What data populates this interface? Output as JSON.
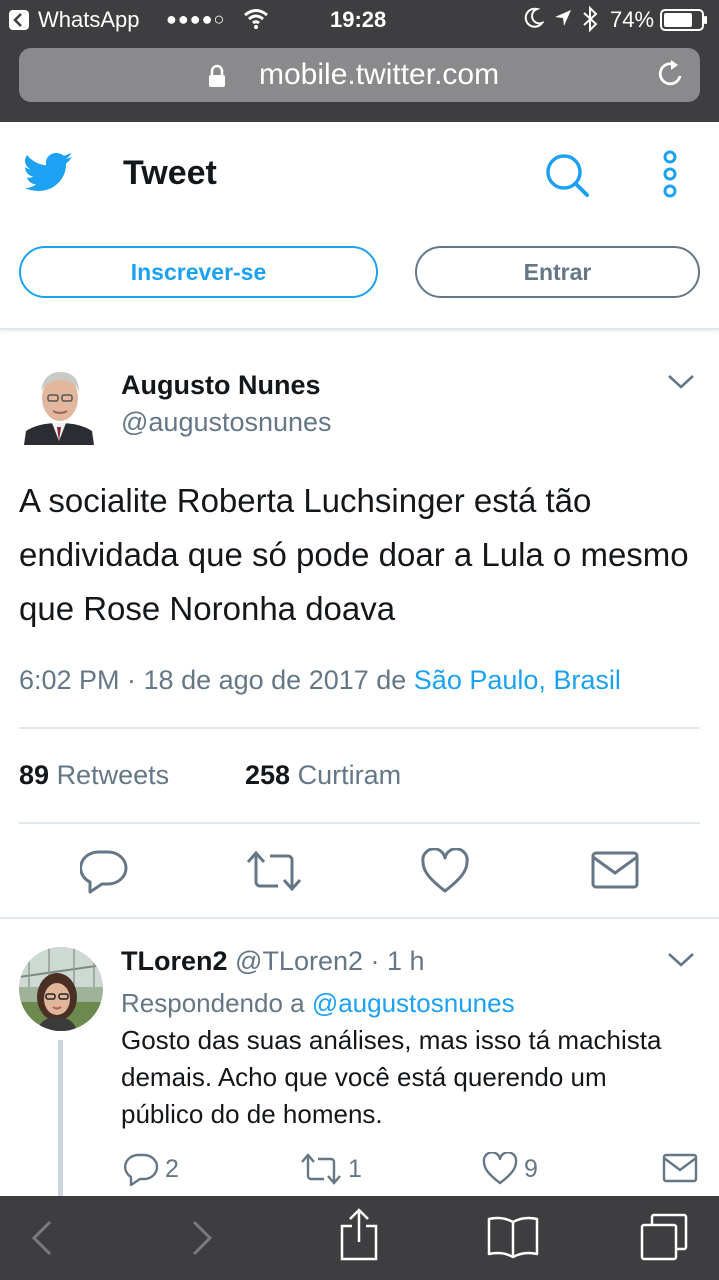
{
  "status_bar": {
    "back_app": "WhatsApp",
    "signal": "●●●●○",
    "time": "19:28",
    "battery": "74%"
  },
  "browser": {
    "url": "mobile.twitter.com"
  },
  "header": {
    "title": "Tweet",
    "signup_label": "Inscrever-se",
    "login_label": "Entrar"
  },
  "tweet": {
    "author_name": "Augusto Nunes",
    "author_handle": "@augustosnunes",
    "text": "A socialite Roberta Luchsinger está tão endividada que só pode doar a Lula o mesmo que Rose Noronha doava",
    "timestamp": "6:02 PM · 18 de ago de 2017 de ",
    "location": "São Paulo, Brasil",
    "retweets_count": "89",
    "retweets_label": "Retweets",
    "likes_count": "258",
    "likes_label": "Curtiram"
  },
  "reply": {
    "author_name": "TLoren2",
    "author_handle": "@TLoren2",
    "time": " · 1 h",
    "replying_prefix": "Respondendo a ",
    "replying_to": "@augustosnunes",
    "text": "Gosto das suas análises, mas isso tá machista demais. Acho que você está querendo um público do de homens.",
    "reply_count": "2",
    "retweet_count": "1",
    "like_count": "9"
  },
  "colors": {
    "twitter_blue": "#1da1f2",
    "muted": "#657786",
    "chrome": "#3e3e40"
  }
}
